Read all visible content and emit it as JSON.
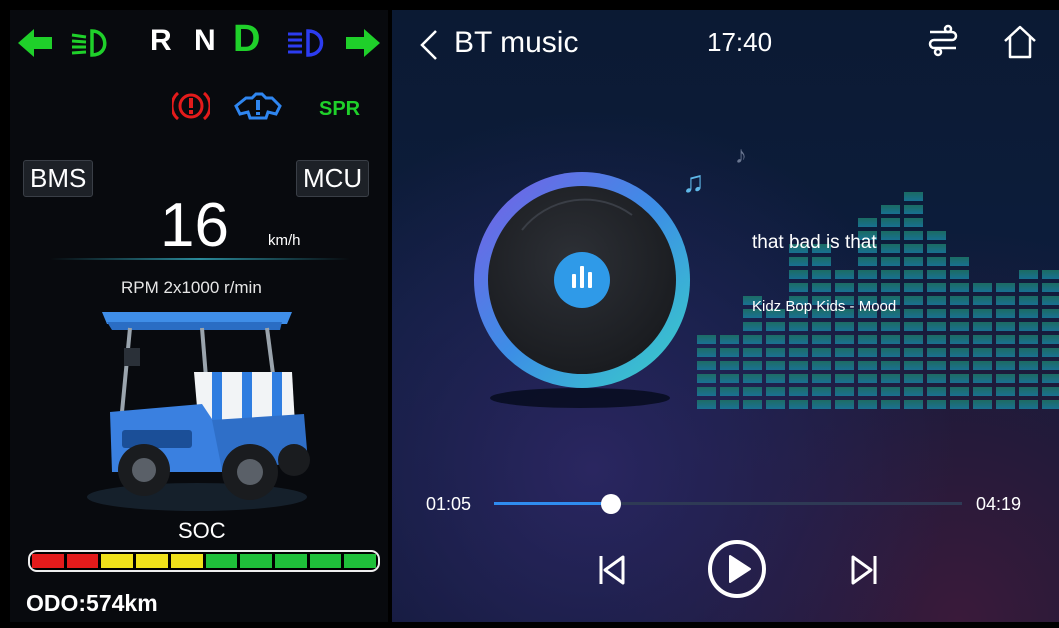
{
  "gears": {
    "r": "R",
    "n": "N",
    "d": "D"
  },
  "cluster": {
    "bms_label": "BMS",
    "mcu_label": "MCU",
    "spr_label": "SPR",
    "speed": "16",
    "speed_unit": "km/h",
    "rpm_label": "RPM 2x1000 r/min",
    "soc_label": "SOC",
    "soc_segments": [
      "#e41b1b",
      "#e41b1b",
      "#f0e11a",
      "#f0e11a",
      "#f0e11a",
      "#1fbf3a",
      "#1fbf3a",
      "#1fbf3a",
      "#1fbf3a",
      "#1fbf3a"
    ],
    "odo": "ODO:574km"
  },
  "player": {
    "title": "BT music",
    "clock": "17:40",
    "lyric": "that bad is that",
    "artist": "Kidz Bop Kids - Mood",
    "current_time": "01:05",
    "total_time": "04:19",
    "progress": 0.25
  },
  "colors": {
    "turn_signal": "#1fd02a",
    "low_beam": "#1fd02a",
    "high_beam": "#2c3cf0",
    "brake_warning": "#e41b1b",
    "fault_warning": "#2f86f0",
    "accent": "#2f8cf0"
  },
  "icons": {
    "left_turn": "arrow-left-icon",
    "right_turn": "arrow-right-icon",
    "low_beam": "low-beam-icon",
    "high_beam": "high-beam-icon",
    "brake": "brake-warning-icon",
    "fault": "fault-warning-icon",
    "back": "chevron-left-icon",
    "settings": "settings-sliders-icon",
    "home": "home-icon",
    "prev": "previous-track-icon",
    "play": "play-icon",
    "next": "next-track-icon"
  }
}
